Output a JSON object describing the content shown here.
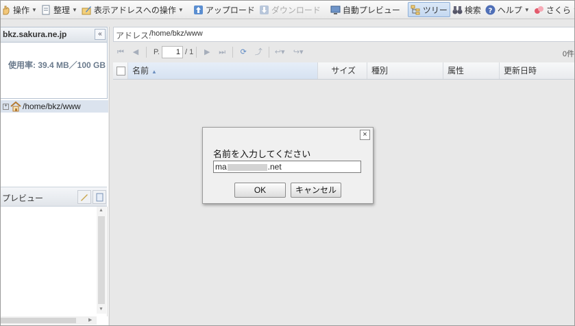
{
  "toolbar": {
    "items": [
      {
        "label": "操作",
        "caret": "▼"
      },
      {
        "label": "整理",
        "caret": "▼"
      },
      {
        "label": "表示アドレスへの操作",
        "caret": "▼"
      },
      {
        "label": "アップロード"
      },
      {
        "label": "ダウンロード"
      },
      {
        "label": "自動プレビュー"
      },
      {
        "label": "ツリー"
      },
      {
        "label": "検索"
      },
      {
        "label": "ヘルプ",
        "caret": "▼"
      },
      {
        "label": "さくら",
        "caret": "▼"
      }
    ]
  },
  "host": {
    "name": "bkz.sakura.ne.jp",
    "collapse": "«",
    "usage": "使用率: 39.4 MB／100 GB"
  },
  "tree": {
    "plus": "+",
    "path": "/home/bkz/www"
  },
  "preview": {
    "title": "プレビュー"
  },
  "address": {
    "label": "アドレス:",
    "value": "/home/bkz/www"
  },
  "pager": {
    "p": "P.",
    "current": "1",
    "of": "/ 1",
    "count": "0件"
  },
  "grid": {
    "columns": [
      "名前",
      "サイズ",
      "種別",
      "属性",
      "更新日時"
    ],
    "sort_indicator": "▲"
  },
  "dialog": {
    "close": "×",
    "message": "名前を入力してください",
    "input_prefix": "ma",
    "input_suffix": ".net",
    "ok": "OK",
    "cancel": "キャンセル"
  },
  "colors": {
    "accent": "#8fb0d8",
    "selected_row": "#dbe3ee"
  }
}
